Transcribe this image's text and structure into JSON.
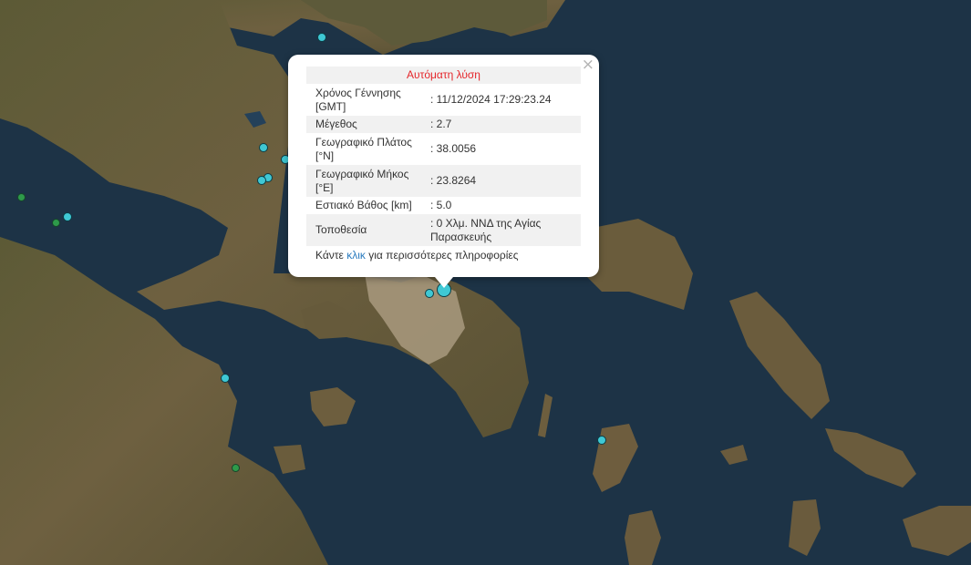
{
  "map": {
    "colors": {
      "sea": "#1d3346",
      "land": "#6b5d3e",
      "land_dark": "#4f4a2e",
      "city": "#b4a48a",
      "quake_cyan": "#3fc8d4",
      "quake_green": "#2e9a4a"
    },
    "markers": [
      {
        "lat": 38.0056,
        "lon": 23.8264,
        "type": "cyan",
        "selected": true
      }
    ]
  },
  "popup": {
    "close_glyph": "×",
    "title": "Αυτόματη λύση",
    "rows": [
      {
        "key": "Χρόνος Γέννησης [GMT]",
        "value": ": 11/12/2024 17:29:23.24"
      },
      {
        "key": "Μέγεθος",
        "value": ": 2.7"
      },
      {
        "key": "Γεωγραφικό Πλάτος [°N]",
        "value": ": 38.0056"
      },
      {
        "key": "Γεωγραφικό Μήκος [°E]",
        "value": ": 23.8264"
      },
      {
        "key": "Εστιακό Βάθος [km]",
        "value": ": 5.0"
      },
      {
        "key": "Τοποθεσία",
        "value": ": 0 Χλμ. ΝΝΔ της Αγίας Παρασκευής"
      }
    ],
    "more_prefix": "Κάντε ",
    "more_link": "κλικ",
    "more_suffix": " για περισσότερες πληροφορίες"
  }
}
